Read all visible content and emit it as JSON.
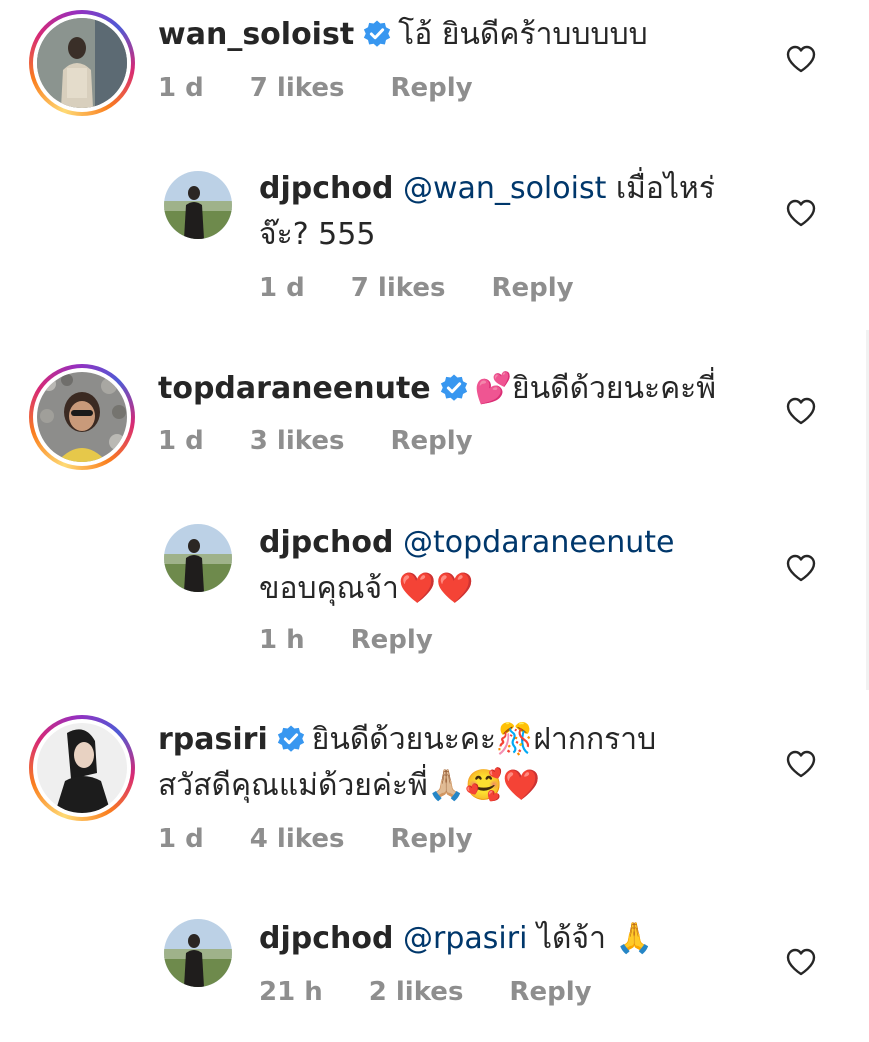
{
  "comments": [
    {
      "user": "wan_soloist",
      "verified": true,
      "text": "โอ้ ยินดีคร้าบบบบบ",
      "time": "1 d",
      "likes": "7 likes",
      "reply": "Reply",
      "avatar": "avatar-wan-soloist",
      "replies": [
        {
          "user": "djpchod",
          "mention": "@wan_soloist",
          "text_line1": "เมื่อไหร่",
          "text_line2": "จ๊ะ? 555",
          "time": "1 d",
          "likes": "7 likes",
          "reply": "Reply",
          "avatar": "avatar-djpchod"
        }
      ]
    },
    {
      "user": "topdaraneenute",
      "verified": true,
      "emoji_prefix": "💕",
      "text": "ยินดีด้วยนะคะพี่",
      "time": "1 d",
      "likes": "3 likes",
      "reply": "Reply",
      "avatar": "avatar-topdaraneenute",
      "replies": [
        {
          "user": "djpchod",
          "mention": "@topdaraneenute",
          "text_line1": "",
          "text_line2": "ขอบคุณจ้า",
          "emoji_suffix": "❤️❤️",
          "time": "1 h",
          "reply": "Reply",
          "avatar": "avatar-djpchod"
        }
      ]
    },
    {
      "user": "rpasiri",
      "verified": true,
      "text_line1a": "ยินดีด้วยนะคะ",
      "emoji_mid": "🎊",
      "text_line1b": "ฝากกราบ",
      "text_line2": "สวัสดีคุณแม่ด้วยค่ะพี่",
      "emoji_suffix": "🙏🏼🥰❤️",
      "time": "1 d",
      "likes": "4 likes",
      "reply": "Reply",
      "avatar": "avatar-rpasiri",
      "replies": [
        {
          "user": "djpchod",
          "mention": "@rpasiri",
          "text_line1": "ได้จ้า",
          "emoji_suffix": "🙏",
          "time": "21 h",
          "likes": "2 likes",
          "reply": "Reply",
          "avatar": "avatar-djpchod"
        }
      ]
    }
  ],
  "colors": {
    "text": "#262626",
    "meta": "#8e8e8e",
    "mention": "#00376b",
    "verified": "#3897f0"
  },
  "icons": {
    "verified": "verified-badge-icon",
    "like": "heart-outline-icon"
  }
}
